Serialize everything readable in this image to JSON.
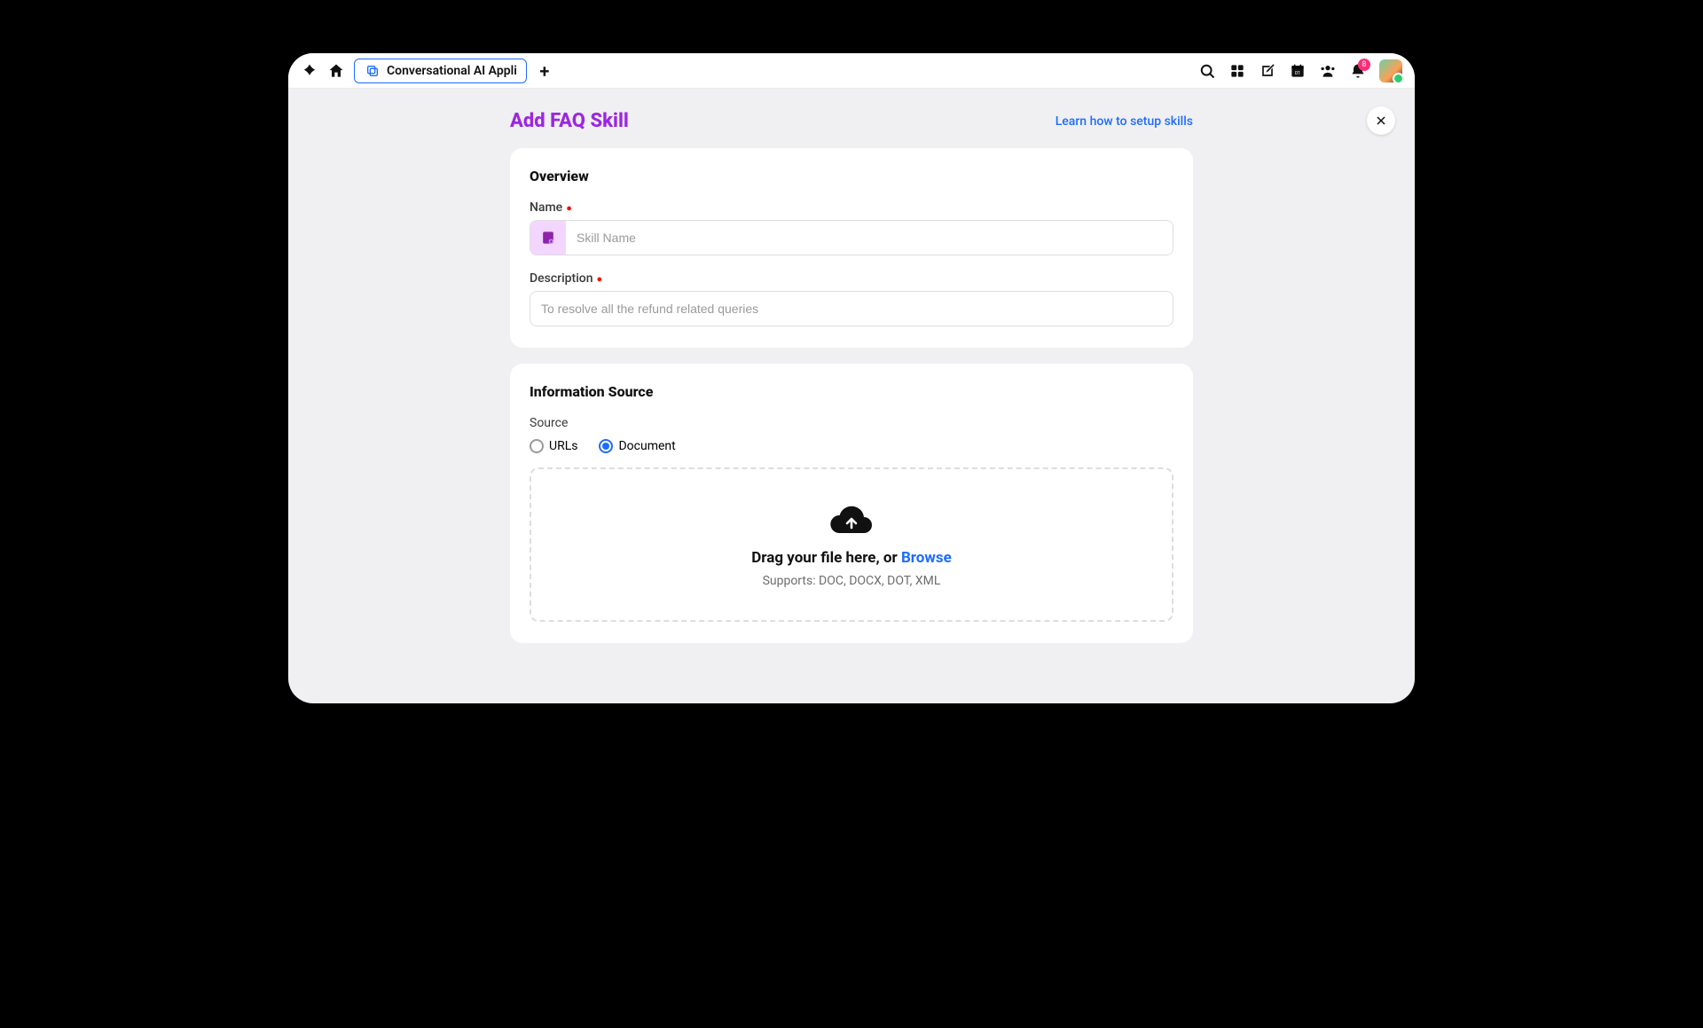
{
  "topbar": {
    "tab_label": "Conversational AI Appli",
    "notif_count": "8"
  },
  "page": {
    "title": "Add FAQ Skill",
    "help_link": "Learn how to setup skills"
  },
  "overview": {
    "section_title": "Overview",
    "name_label": "Name",
    "name_placeholder": "Skill Name",
    "name_value": "",
    "description_label": "Description",
    "description_placeholder": "To resolve all the refund related queries",
    "description_value": ""
  },
  "info_source": {
    "section_title": "Information Source",
    "source_label": "Source",
    "options": {
      "urls": "URLs",
      "document": "Document"
    },
    "selected": "document",
    "drop_text": "Drag your file here, or ",
    "browse": "Browse",
    "supports": "Supports: DOC, DOCX, DOT, XML"
  }
}
